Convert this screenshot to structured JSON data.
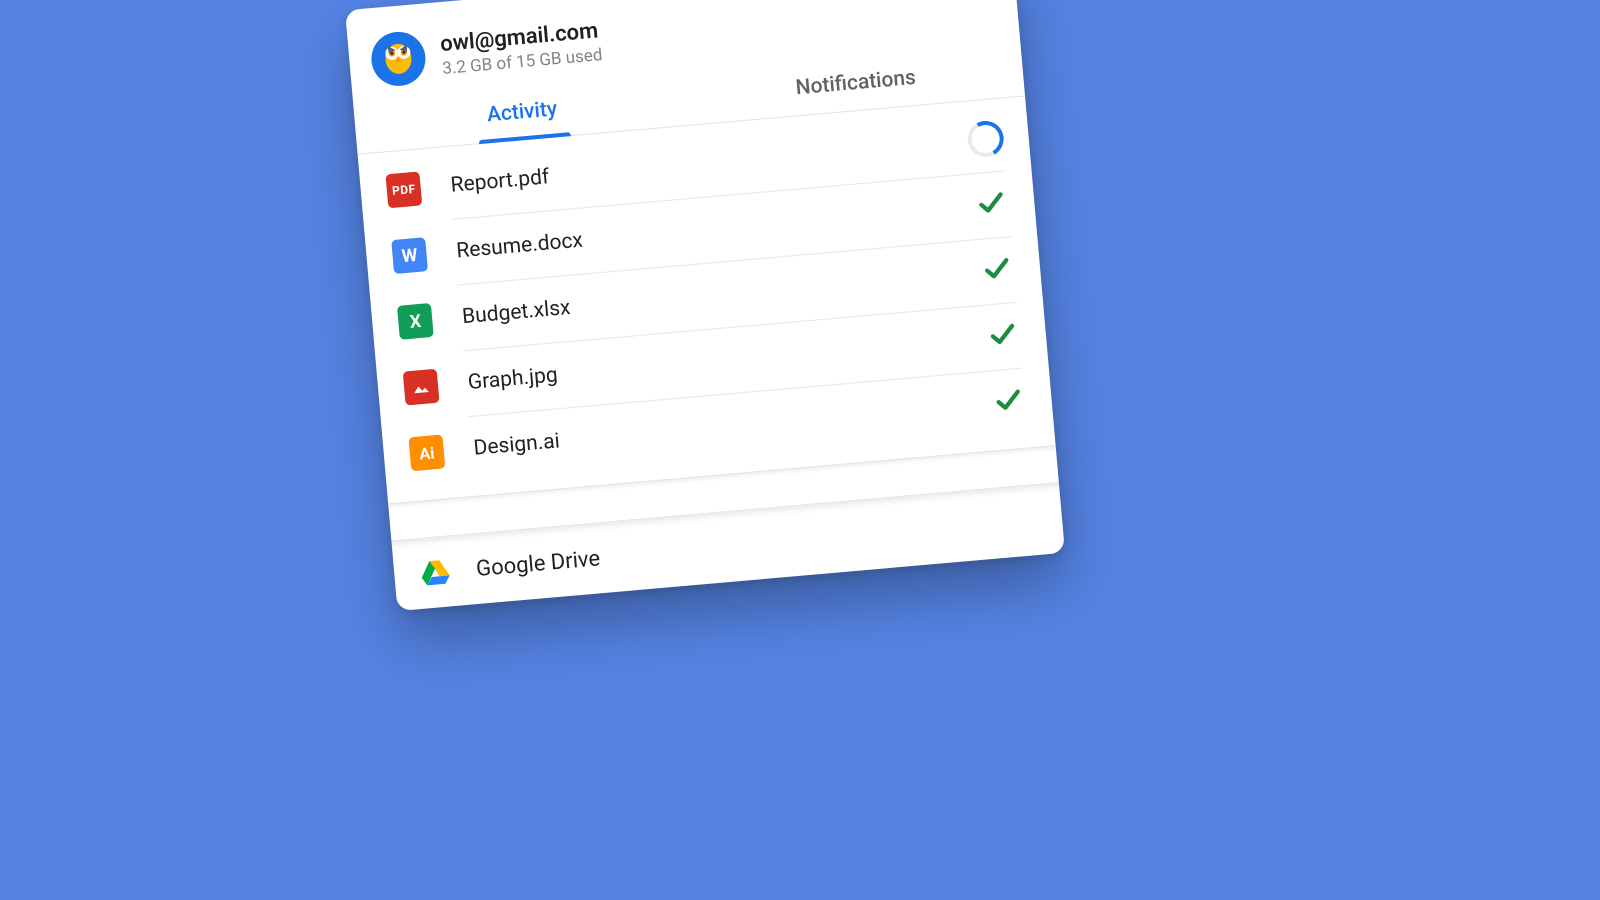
{
  "account": {
    "email": "owl@gmail.com",
    "storage": "3.2 GB of 15 GB used"
  },
  "tabs": {
    "activity": "Activity",
    "notifications": "Notifications",
    "active": "activity"
  },
  "files": [
    {
      "name": "Report.pdf",
      "type": "pdf",
      "icon_label": "PDF",
      "status": "uploading"
    },
    {
      "name": "Resume.docx",
      "type": "doc",
      "icon_label": "W",
      "status": "done"
    },
    {
      "name": "Budget.xlsx",
      "type": "xls",
      "icon_label": "X",
      "status": "done"
    },
    {
      "name": "Graph.jpg",
      "type": "img",
      "icon_label": "",
      "status": "done"
    },
    {
      "name": "Design.ai",
      "type": "ai",
      "icon_label": "Ai",
      "status": "done"
    }
  ],
  "footer": {
    "label": "Google Drive"
  }
}
